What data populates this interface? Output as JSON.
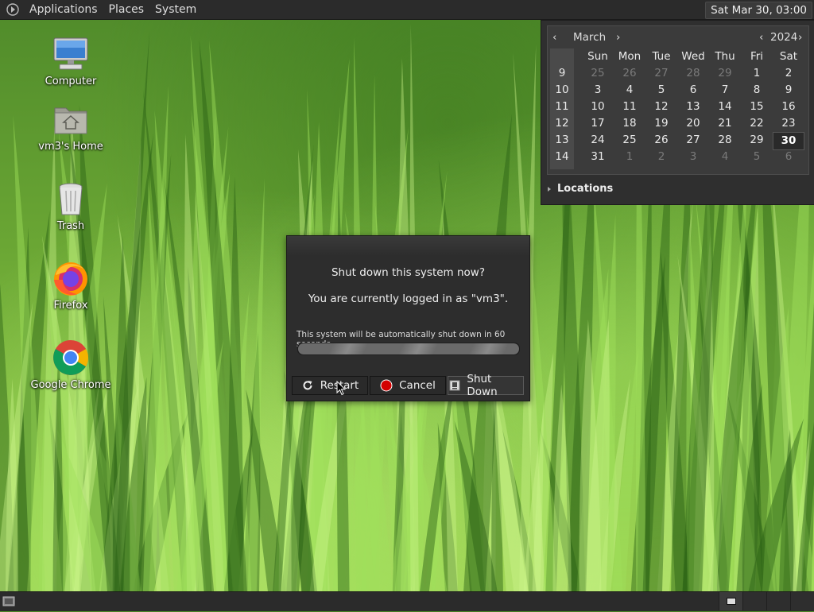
{
  "top_panel": {
    "menus": [
      "Applications",
      "Places",
      "System"
    ],
    "clock": "Sat Mar 30, 03:00"
  },
  "desktop_icons": [
    {
      "label": "Computer",
      "icon": "computer-icon"
    },
    {
      "label": "vm3's Home",
      "icon": "home-folder-icon"
    },
    {
      "label": "Trash",
      "icon": "trash-icon"
    },
    {
      "label": "Firefox",
      "icon": "firefox-icon"
    },
    {
      "label": "Google Chrome",
      "icon": "chrome-icon"
    }
  ],
  "calendar": {
    "month": "March",
    "year": "2024",
    "weekdays": [
      "Sun",
      "Mon",
      "Tue",
      "Wed",
      "Thu",
      "Fri",
      "Sat"
    ],
    "weeks": [
      {
        "num": "9",
        "days": [
          "25",
          "26",
          "27",
          "28",
          "29",
          "1",
          "2"
        ]
      },
      {
        "num": "10",
        "days": [
          "3",
          "4",
          "5",
          "6",
          "7",
          "8",
          "9"
        ]
      },
      {
        "num": "11",
        "days": [
          "10",
          "11",
          "12",
          "13",
          "14",
          "15",
          "16"
        ]
      },
      {
        "num": "12",
        "days": [
          "17",
          "18",
          "19",
          "20",
          "21",
          "22",
          "23"
        ]
      },
      {
        "num": "13",
        "days": [
          "24",
          "25",
          "26",
          "27",
          "28",
          "29",
          "30"
        ]
      },
      {
        "num": "14",
        "days": [
          "31",
          "1",
          "2",
          "3",
          "4",
          "5",
          "6"
        ]
      }
    ],
    "today": "30",
    "locations_label": "Locations"
  },
  "dialog": {
    "title": "Shut down this system now?",
    "user_text": "You are currently logged in as \"vm3\".",
    "auto_text": "This system will be automatically shut down in 60 seconds",
    "progress_fraction": 1.0,
    "buttons": {
      "restart": "Restart",
      "cancel": "Cancel",
      "shutdown": "Shut Down"
    }
  },
  "colors": {
    "panel_bg": "#2b2b2b",
    "dialog_bg": "#2d2d2d",
    "cancel_red": "#d40000",
    "grass_green": "#6aa634"
  }
}
